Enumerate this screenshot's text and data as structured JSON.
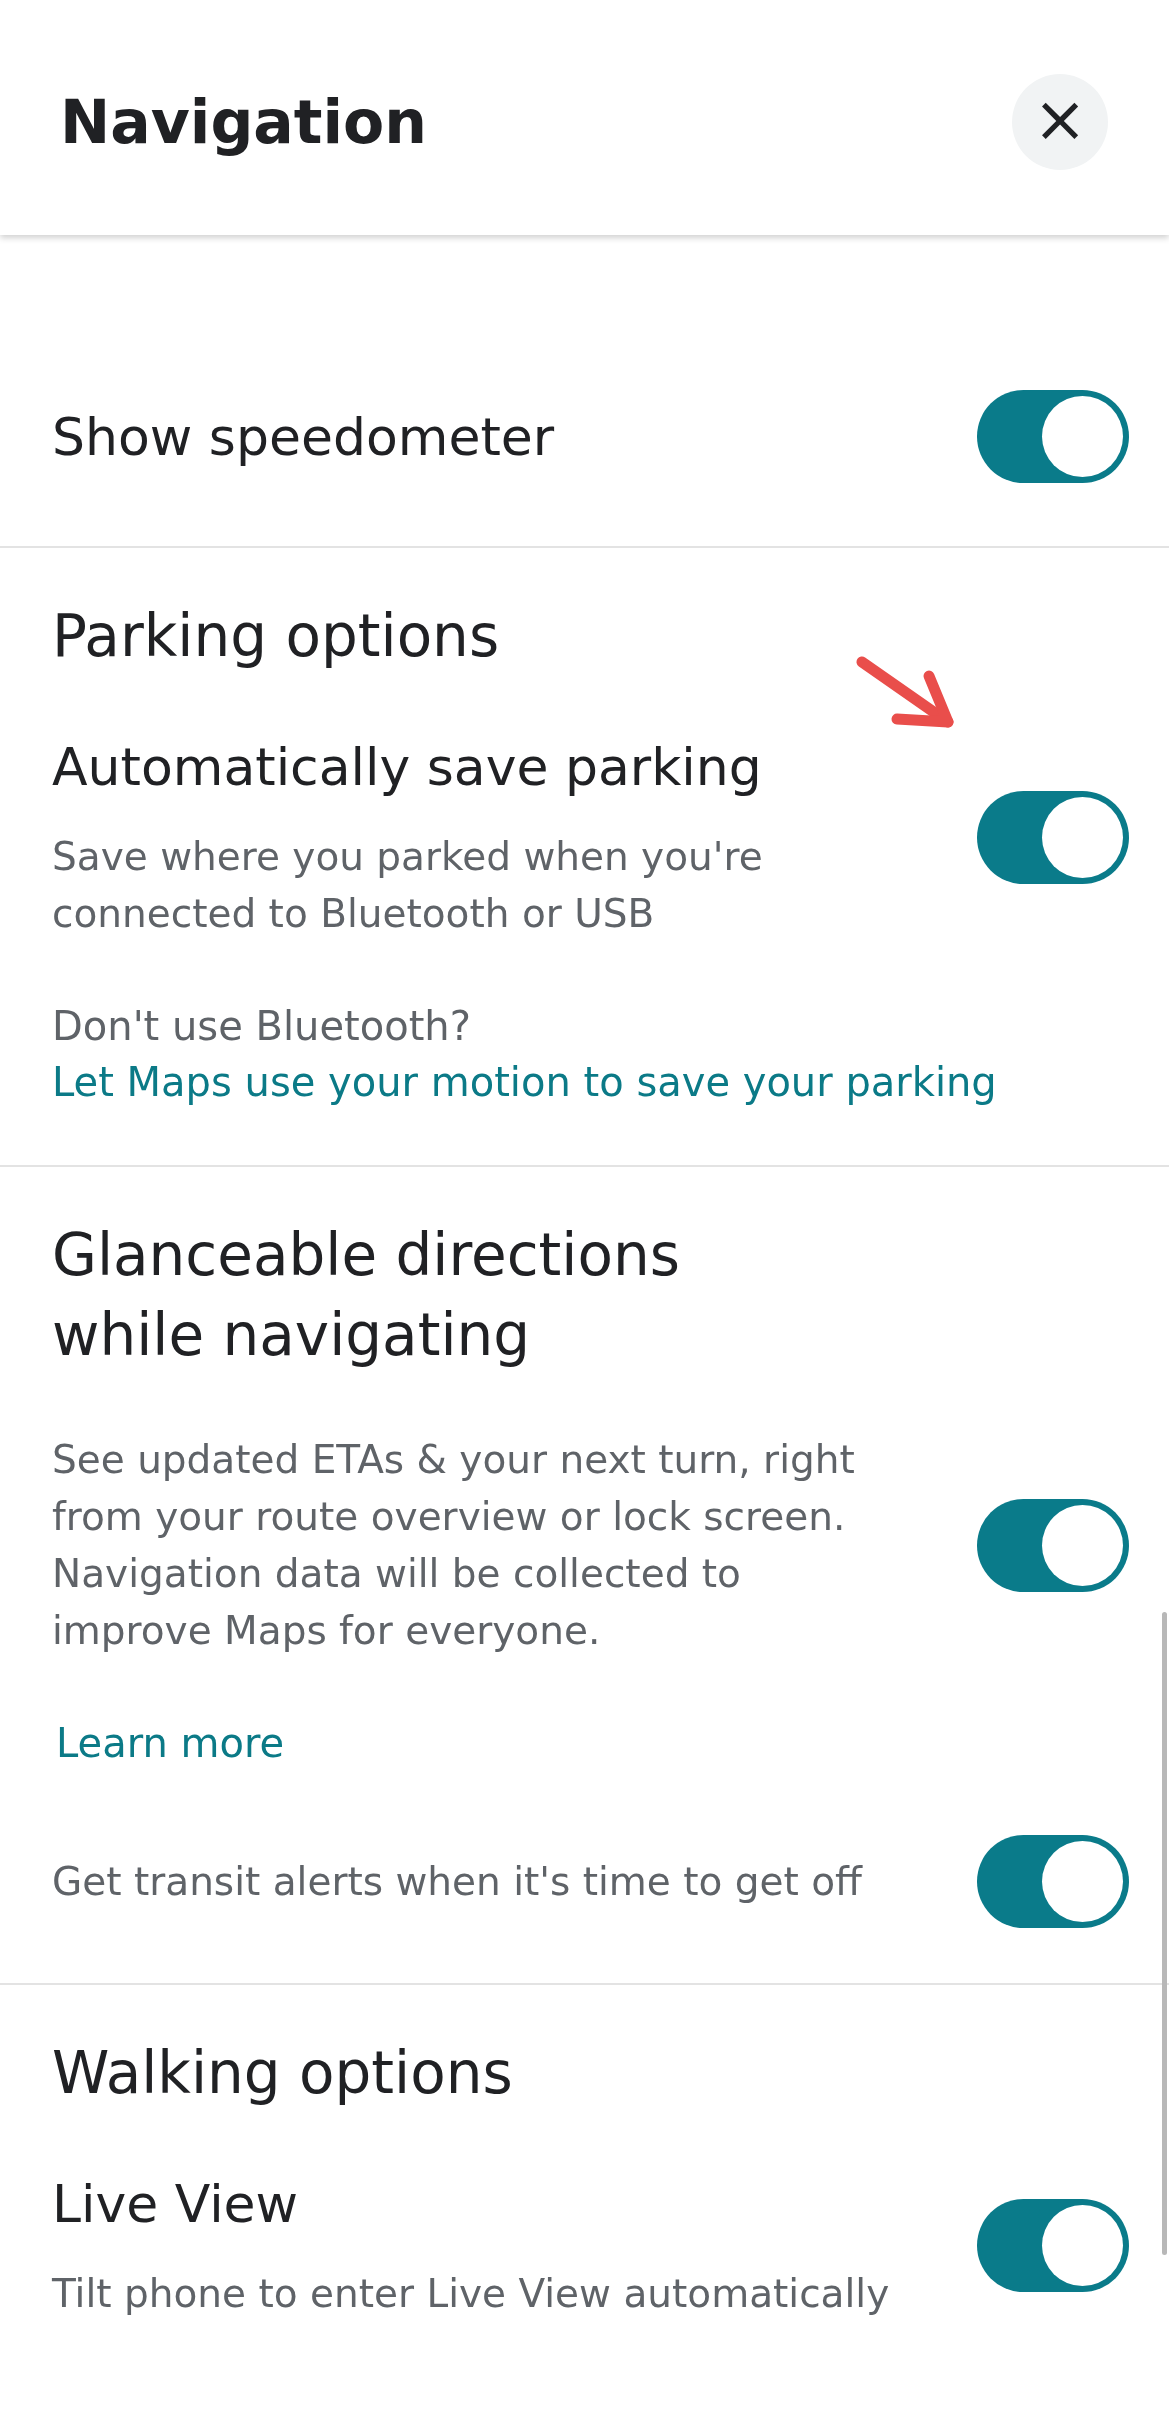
{
  "header": {
    "title": "Navigation",
    "close": "×"
  },
  "sections": [
    {
      "items": [
        {
          "kind": "toggle",
          "title": "Show speedometer",
          "on": true,
          "marked": false
        }
      ]
    },
    {
      "heading": "Parking options",
      "items": [
        {
          "kind": "toggle",
          "title": "Automatically save parking",
          "description": "Save where you parked when you're connected to Bluetooth or USB",
          "on": true,
          "marked": true
        },
        {
          "kind": "note",
          "text": "Don't use Bluetooth?",
          "link": "Let Maps use your motion to save your parking"
        }
      ]
    },
    {
      "heading": "Glanceable directions while navigating",
      "items": [
        {
          "kind": "toggle",
          "description": "See updated ETAs & your next turn, right from your route overview or lock screen. Navigation data will be collected to improve Maps for everyone.",
          "on": true,
          "marked": false
        },
        {
          "kind": "link",
          "label": "Learn more"
        },
        {
          "kind": "toggle",
          "description": "Get transit alerts when it's time to get off",
          "on": true,
          "marked": false
        }
      ]
    },
    {
      "heading": "Walking options",
      "items": [
        {
          "kind": "toggle",
          "title": "Live View",
          "description": "Tilt phone to enter Live View automatically",
          "on": true,
          "marked": false
        }
      ]
    }
  ]
}
